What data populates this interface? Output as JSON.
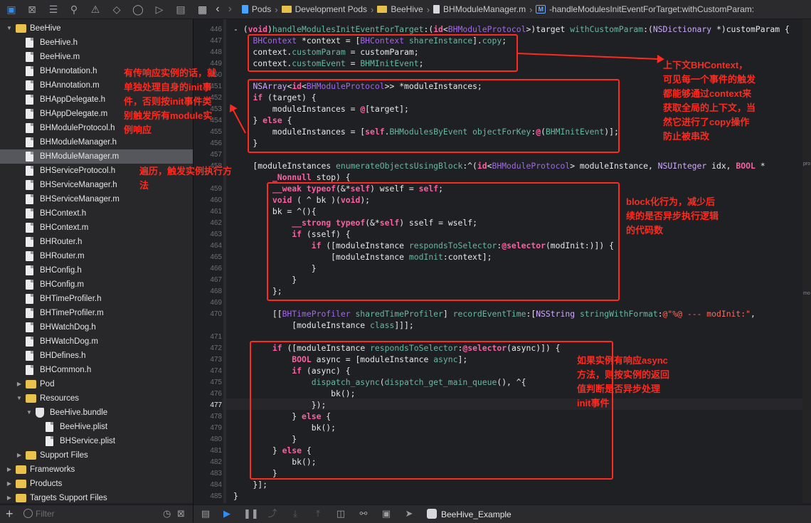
{
  "jumpbar": {
    "crumbs": [
      "Pods",
      "Development Pods",
      "BeeHive",
      "BHModuleManager.m",
      "-handleModulesInitEventForTarget:withCustomParam:"
    ],
    "method_badge": "M"
  },
  "navigator": {
    "items": [
      {
        "label": "BeeHive",
        "kind": "folder",
        "depth": 1,
        "disclosure": "open"
      },
      {
        "label": "BeeHive.h",
        "kind": "file",
        "depth": 2
      },
      {
        "label": "BeeHive.m",
        "kind": "file",
        "depth": 2
      },
      {
        "label": "BHAnnotation.h",
        "kind": "file",
        "depth": 2
      },
      {
        "label": "BHAnnotation.m",
        "kind": "file",
        "depth": 2
      },
      {
        "label": "BHAppDelegate.h",
        "kind": "file",
        "depth": 2
      },
      {
        "label": "BHAppDelegate.m",
        "kind": "file",
        "depth": 2
      },
      {
        "label": "BHModuleProtocol.h",
        "kind": "file",
        "depth": 2
      },
      {
        "label": "BHModuleManager.h",
        "kind": "file",
        "depth": 2
      },
      {
        "label": "BHModuleManager.m",
        "kind": "file",
        "depth": 2,
        "selected": true
      },
      {
        "label": "BHServiceProtocol.h",
        "kind": "file",
        "depth": 2
      },
      {
        "label": "BHServiceManager.h",
        "kind": "file",
        "depth": 2
      },
      {
        "label": "BHServiceManager.m",
        "kind": "file",
        "depth": 2
      },
      {
        "label": "BHContext.h",
        "kind": "file",
        "depth": 2
      },
      {
        "label": "BHContext.m",
        "kind": "file",
        "depth": 2
      },
      {
        "label": "BHRouter.h",
        "kind": "file",
        "depth": 2
      },
      {
        "label": "BHRouter.m",
        "kind": "file",
        "depth": 2
      },
      {
        "label": "BHConfig.h",
        "kind": "file",
        "depth": 2
      },
      {
        "label": "BHConfig.m",
        "kind": "file",
        "depth": 2
      },
      {
        "label": "BHTimeProfiler.h",
        "kind": "file",
        "depth": 2
      },
      {
        "label": "BHTimeProfiler.m",
        "kind": "file",
        "depth": 2
      },
      {
        "label": "BHWatchDog.h",
        "kind": "file",
        "depth": 2
      },
      {
        "label": "BHWatchDog.m",
        "kind": "file",
        "depth": 2
      },
      {
        "label": "BHDefines.h",
        "kind": "file",
        "depth": 2
      },
      {
        "label": "BHCommon.h",
        "kind": "file",
        "depth": 2
      },
      {
        "label": "Pod",
        "kind": "folder",
        "depth": 2,
        "disclosure": "closed"
      },
      {
        "label": "Resources",
        "kind": "folder",
        "depth": 2,
        "disclosure": "open"
      },
      {
        "label": "BeeHive.bundle",
        "kind": "bundle",
        "depth": 3,
        "disclosure": "open"
      },
      {
        "label": "BeeHive.plist",
        "kind": "file",
        "depth": 4
      },
      {
        "label": "BHService.plist",
        "kind": "file",
        "depth": 4
      },
      {
        "label": "Support Files",
        "kind": "folder",
        "depth": 2,
        "disclosure": "closed"
      },
      {
        "label": "Frameworks",
        "kind": "folder",
        "depth": 1,
        "disclosure": "closed"
      },
      {
        "label": "Products",
        "kind": "folder",
        "depth": 1,
        "disclosure": "closed"
      },
      {
        "label": "Targets Support Files",
        "kind": "folder",
        "depth": 1,
        "disclosure": "closed"
      }
    ],
    "filter_placeholder": "Filter",
    "add_label": "+"
  },
  "editor": {
    "current_line": "477",
    "lines": [
      {
        "n": "446",
        "seg": [
          [
            "pl",
            "- ("
          ],
          [
            "kw",
            "void"
          ],
          [
            "pl",
            ")"
          ],
          [
            "fn",
            "handleModulesInitEventForTarget"
          ],
          [
            "pl",
            ":("
          ],
          [
            "kw",
            "id"
          ],
          [
            "pl",
            "<"
          ],
          [
            "cls",
            "BHModuleProtocol"
          ],
          [
            "pl",
            ">)target "
          ],
          [
            "fn",
            "withCustomParam"
          ],
          [
            "pl",
            ":("
          ],
          [
            "ty",
            "NSDictionary"
          ],
          [
            "pl",
            " *)customParam {"
          ]
        ]
      },
      {
        "n": "447",
        "seg": [
          [
            "pl",
            "    "
          ],
          [
            "cls",
            "BHContext"
          ],
          [
            "pl",
            " *context = ["
          ],
          [
            "cls",
            "BHContext"
          ],
          [
            "pl",
            " "
          ],
          [
            "fn",
            "shareInstance"
          ],
          [
            "pl",
            "]."
          ],
          [
            "fn",
            "copy"
          ],
          [
            "pl",
            ";"
          ]
        ]
      },
      {
        "n": "448",
        "seg": [
          [
            "pl",
            "    context."
          ],
          [
            "fn",
            "customParam"
          ],
          [
            "pl",
            " = customParam;"
          ]
        ]
      },
      {
        "n": "449",
        "seg": [
          [
            "pl",
            "    context."
          ],
          [
            "fn",
            "customEvent"
          ],
          [
            "pl",
            " = "
          ],
          [
            "fn",
            "BHMInitEvent"
          ],
          [
            "pl",
            ";"
          ]
        ]
      },
      {
        "n": "450",
        "seg": []
      },
      {
        "n": "451",
        "seg": [
          [
            "pl",
            "    "
          ],
          [
            "ty",
            "NSArray"
          ],
          [
            "pl",
            "<"
          ],
          [
            "kw",
            "id"
          ],
          [
            "pl",
            "<"
          ],
          [
            "cls",
            "BHModuleProtocol"
          ],
          [
            "pl",
            ">> *moduleInstances;"
          ]
        ]
      },
      {
        "n": "452",
        "seg": [
          [
            "pl",
            "    "
          ],
          [
            "kw",
            "if"
          ],
          [
            "pl",
            " (target) {"
          ]
        ]
      },
      {
        "n": "453",
        "seg": [
          [
            "pl",
            "        moduleInstances = "
          ],
          [
            "kw",
            "@"
          ],
          [
            "pl",
            "[target];"
          ]
        ]
      },
      {
        "n": "454",
        "seg": [
          [
            "pl",
            "    } "
          ],
          [
            "kw",
            "else"
          ],
          [
            "pl",
            " {"
          ]
        ]
      },
      {
        "n": "455",
        "seg": [
          [
            "pl",
            "        moduleInstances = ["
          ],
          [
            "kw",
            "self"
          ],
          [
            "pl",
            "."
          ],
          [
            "fn",
            "BHModulesByEvent"
          ],
          [
            "pl",
            " "
          ],
          [
            "fn",
            "objectForKey"
          ],
          [
            "pl",
            ":"
          ],
          [
            "kw",
            "@"
          ],
          [
            "pl",
            "("
          ],
          [
            "fn",
            "BHMInitEvent"
          ],
          [
            "pl",
            ")];"
          ]
        ]
      },
      {
        "n": "456",
        "seg": [
          [
            "pl",
            "    }"
          ]
        ]
      },
      {
        "n": "457",
        "seg": []
      },
      {
        "n": "458",
        "seg": [
          [
            "pl",
            "    [moduleInstances "
          ],
          [
            "fn",
            "enumerateObjectsUsingBlock"
          ],
          [
            "pl",
            ":^("
          ],
          [
            "kw",
            "id"
          ],
          [
            "pl",
            "<"
          ],
          [
            "cls",
            "BHModuleProtocol"
          ],
          [
            "pl",
            "> moduleInstance, "
          ],
          [
            "ty",
            "NSUInteger"
          ],
          [
            "pl",
            " idx, "
          ],
          [
            "kw",
            "BOOL"
          ],
          [
            "pl",
            " *"
          ]
        ]
      },
      {
        "n": "",
        "seg": [
          [
            "pl",
            "        "
          ],
          [
            "kw",
            "_Nonnull"
          ],
          [
            "pl",
            " stop) {"
          ]
        ]
      },
      {
        "n": "459",
        "seg": [
          [
            "pl",
            "        "
          ],
          [
            "kw",
            "__weak"
          ],
          [
            "pl",
            " "
          ],
          [
            "kw",
            "typeof"
          ],
          [
            "pl",
            "(&*"
          ],
          [
            "kw",
            "self"
          ],
          [
            "pl",
            ") wself = "
          ],
          [
            "kw",
            "self"
          ],
          [
            "pl",
            ";"
          ]
        ]
      },
      {
        "n": "460",
        "seg": [
          [
            "pl",
            "        "
          ],
          [
            "kw",
            "void"
          ],
          [
            "pl",
            " ( ^ bk )("
          ],
          [
            "kw",
            "void"
          ],
          [
            "pl",
            ");"
          ]
        ]
      },
      {
        "n": "461",
        "seg": [
          [
            "pl",
            "        bk = ^(){"
          ]
        ]
      },
      {
        "n": "462",
        "seg": [
          [
            "pl",
            "            "
          ],
          [
            "kw",
            "__strong"
          ],
          [
            "pl",
            " "
          ],
          [
            "kw",
            "typeof"
          ],
          [
            "pl",
            "(&*"
          ],
          [
            "kw",
            "self"
          ],
          [
            "pl",
            ") sself = wself;"
          ]
        ]
      },
      {
        "n": "463",
        "seg": [
          [
            "pl",
            "            "
          ],
          [
            "kw",
            "if"
          ],
          [
            "pl",
            " (sself) {"
          ]
        ]
      },
      {
        "n": "464",
        "seg": [
          [
            "pl",
            "                "
          ],
          [
            "kw",
            "if"
          ],
          [
            "pl",
            " ([moduleInstance "
          ],
          [
            "fn",
            "respondsToSelector"
          ],
          [
            "pl",
            ":"
          ],
          [
            "kw",
            "@selector"
          ],
          [
            "pl",
            "(modInit:)]) {"
          ]
        ]
      },
      {
        "n": "465",
        "seg": [
          [
            "pl",
            "                    [moduleInstance "
          ],
          [
            "fn",
            "modInit"
          ],
          [
            "pl",
            ":context];"
          ]
        ]
      },
      {
        "n": "466",
        "seg": [
          [
            "pl",
            "                }"
          ]
        ]
      },
      {
        "n": "467",
        "seg": [
          [
            "pl",
            "            }"
          ]
        ]
      },
      {
        "n": "468",
        "seg": [
          [
            "pl",
            "        };"
          ]
        ]
      },
      {
        "n": "469",
        "seg": []
      },
      {
        "n": "470",
        "seg": [
          [
            "pl",
            "        [["
          ],
          [
            "cls",
            "BHTimeProfiler"
          ],
          [
            "pl",
            " "
          ],
          [
            "fn",
            "sharedTimeProfiler"
          ],
          [
            "pl",
            "] "
          ],
          [
            "fn",
            "recordEventTime"
          ],
          [
            "pl",
            ":["
          ],
          [
            "ty",
            "NSString"
          ],
          [
            "pl",
            " "
          ],
          [
            "fn",
            "stringWithFormat"
          ],
          [
            "pl",
            ":"
          ],
          [
            "str",
            "@\"%@ --- modInit:\""
          ],
          [
            "pl",
            ","
          ]
        ]
      },
      {
        "n": "",
        "seg": [
          [
            "pl",
            "            [moduleInstance "
          ],
          [
            "fn",
            "class"
          ],
          [
            "pl",
            "]]];"
          ]
        ]
      },
      {
        "n": "471",
        "seg": []
      },
      {
        "n": "472",
        "seg": [
          [
            "pl",
            "        "
          ],
          [
            "kw",
            "if"
          ],
          [
            "pl",
            " ([moduleInstance "
          ],
          [
            "fn",
            "respondsToSelector"
          ],
          [
            "pl",
            ":"
          ],
          [
            "kw",
            "@selector"
          ],
          [
            "pl",
            "(async)]) {"
          ]
        ]
      },
      {
        "n": "473",
        "seg": [
          [
            "pl",
            "            "
          ],
          [
            "kw",
            "BOOL"
          ],
          [
            "pl",
            " async = [moduleInstance "
          ],
          [
            "fn",
            "async"
          ],
          [
            "pl",
            "];"
          ]
        ]
      },
      {
        "n": "474",
        "seg": [
          [
            "pl",
            "            "
          ],
          [
            "kw",
            "if"
          ],
          [
            "pl",
            " (async) {"
          ]
        ]
      },
      {
        "n": "475",
        "seg": [
          [
            "pl",
            "                "
          ],
          [
            "fn",
            "dispatch_async"
          ],
          [
            "pl",
            "("
          ],
          [
            "fn",
            "dispatch_get_main_queue"
          ],
          [
            "pl",
            "(), ^{"
          ]
        ]
      },
      {
        "n": "476",
        "seg": [
          [
            "pl",
            "                    bk();"
          ]
        ]
      },
      {
        "n": "477",
        "seg": [
          [
            "pl",
            "                });"
          ]
        ]
      },
      {
        "n": "478",
        "seg": [
          [
            "pl",
            "            } "
          ],
          [
            "kw",
            "else"
          ],
          [
            "pl",
            " {"
          ]
        ]
      },
      {
        "n": "479",
        "seg": [
          [
            "pl",
            "                bk();"
          ]
        ]
      },
      {
        "n": "480",
        "seg": [
          [
            "pl",
            "            }"
          ]
        ]
      },
      {
        "n": "481",
        "seg": [
          [
            "pl",
            "        } "
          ],
          [
            "kw",
            "else"
          ],
          [
            "pl",
            " {"
          ]
        ]
      },
      {
        "n": "482",
        "seg": [
          [
            "pl",
            "            bk();"
          ]
        ]
      },
      {
        "n": "483",
        "seg": [
          [
            "pl",
            "        }"
          ]
        ]
      },
      {
        "n": "484",
        "seg": [
          [
            "pl",
            "    }];"
          ]
        ]
      },
      {
        "n": "485",
        "seg": [
          [
            "pl",
            "}"
          ]
        ]
      }
    ]
  },
  "annotations": {
    "note_context": "上下文BHContext，\n可见每一个事件的触发\n都能够通过context来\n获取全局的上下文，当\n然它进行了copy操作\n防止被串改",
    "note_target": "有传响应实例的话，就\n单独处理自身的init事\n件，否则按init事件类\n别触发所有module实\n例响应",
    "note_enumerate": "遍历，触发实例执行方\n法",
    "note_block": "block化行为，减少后\n续的是否异步执行逻辑\n的代码数",
    "note_async": "如果实例有响应async\n方法，则按实例的返回\n值判断是否异步处理\ninit事件"
  },
  "minimap": {
    "label_1": "pro",
    "label_2": "mo"
  },
  "debugbar": {
    "scheme": "BeeHive_Example"
  },
  "colors": {
    "annotation": "#ff2a1f",
    "keyword": "#fc5fa3",
    "accent": "#2f8cf5"
  }
}
